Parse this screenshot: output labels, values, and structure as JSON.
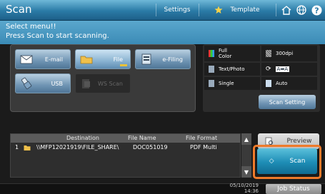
{
  "header": {
    "title": "Scan",
    "settings_label": "Settings",
    "template_label": "Template",
    "icons": [
      "star-icon",
      "home-icon",
      "globe-icon",
      "help-icon"
    ]
  },
  "message": {
    "line1": "Select menu!!",
    "line2": "Press Scan to start scanning."
  },
  "functions": {
    "email": "E-mail",
    "file": "File",
    "efiling": "e-Filing",
    "usb": "USB",
    "wsscan": "WS Scan"
  },
  "scan_settings": {
    "color_l1": "Full",
    "color_l2": "Color",
    "resolution": "300dpi",
    "mode": "Text/Photo",
    "duplex": "Single",
    "auto": "Auto",
    "button": "Scan Setting"
  },
  "destination_table": {
    "headers": [
      "Destination",
      "File Name",
      "File Format"
    ],
    "rows": [
      {
        "index": "1",
        "destination": "\\\\MFP12021919\\FILE_SHARE\\",
        "file_name": "DOC051019",
        "file_format": "PDF Multi"
      }
    ]
  },
  "actions": {
    "preview": "Preview",
    "scan": "Scan",
    "job_status": "Job Status"
  },
  "status": {
    "date": "05/10/2019",
    "time": "14:36"
  },
  "colors": {
    "accent": "#2a7aa6",
    "highlight": "#ef7a2a",
    "scan_button": "#1e8db5"
  }
}
